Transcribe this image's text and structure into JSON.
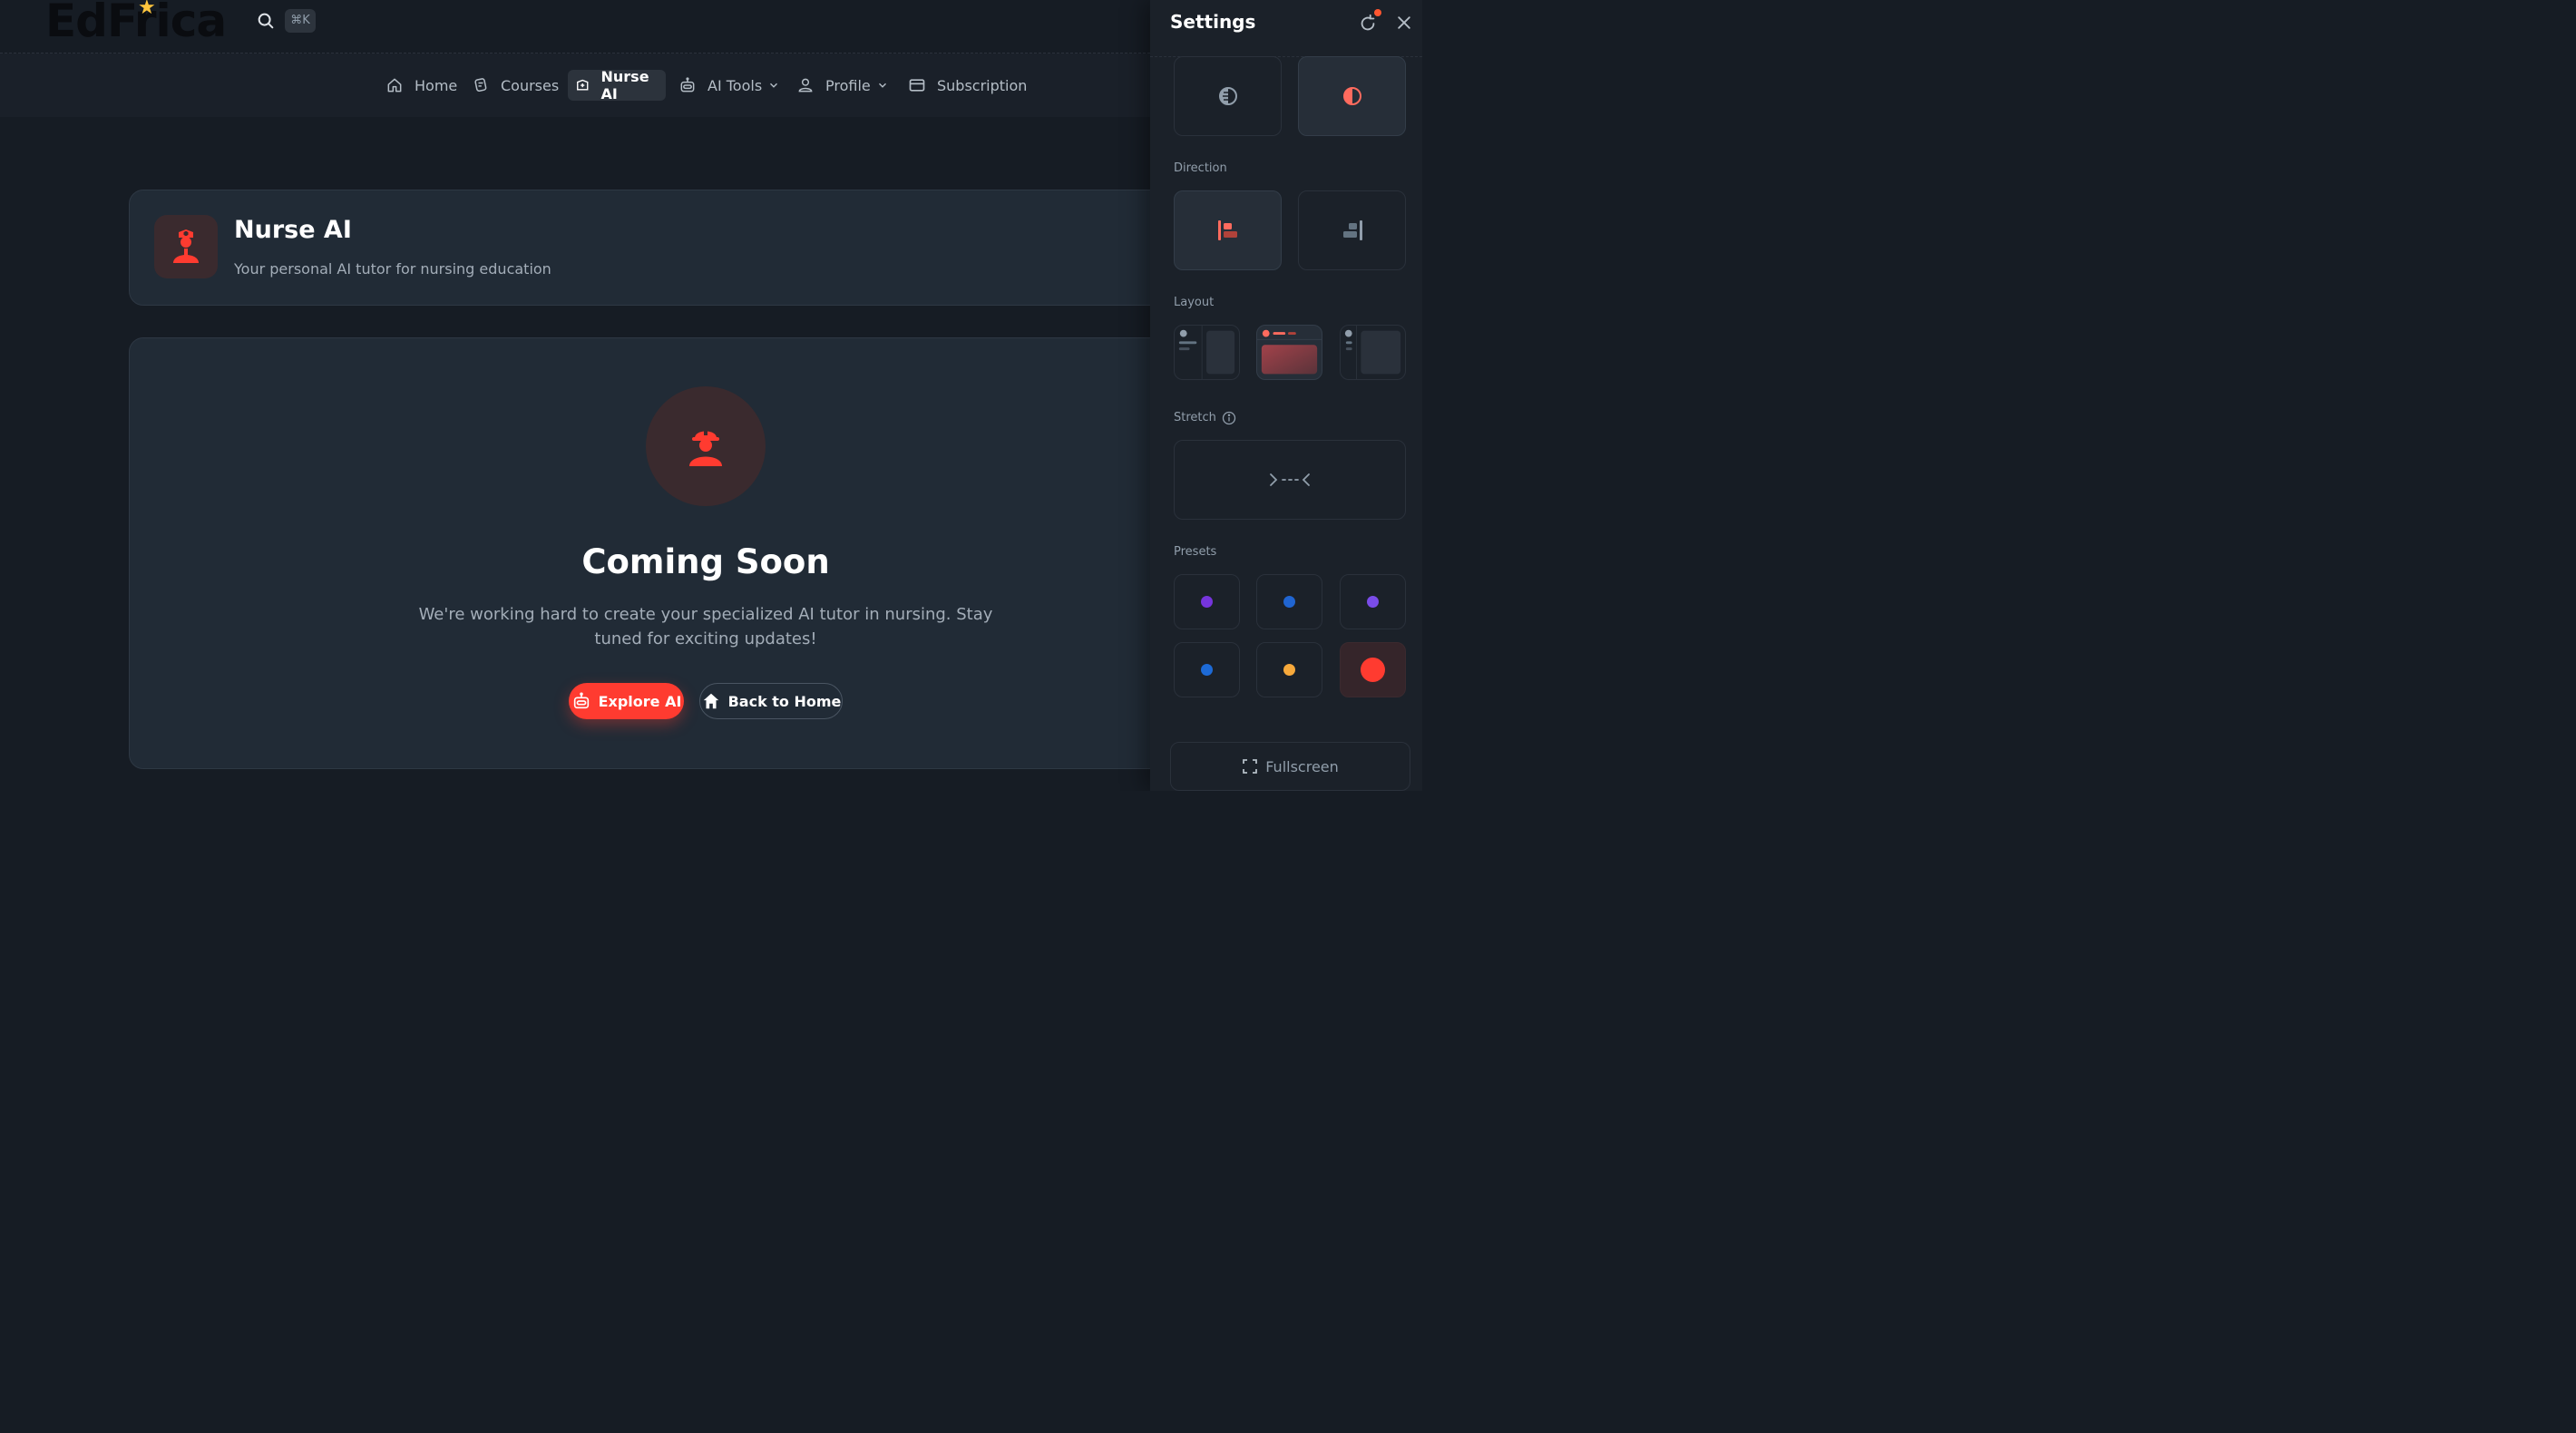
{
  "brand": {
    "logo_text": "EdFrica"
  },
  "search": {
    "shortcut": "⌘K"
  },
  "nav": {
    "items": [
      {
        "label": "Home",
        "icon": "home-icon"
      },
      {
        "label": "Courses",
        "icon": "courses-icon"
      },
      {
        "label": "Nurse AI",
        "icon": "nurse-icon",
        "active": true
      },
      {
        "label": "AI Tools",
        "icon": "robot-icon",
        "dropdown": true
      },
      {
        "label": "Profile",
        "icon": "user-icon",
        "dropdown": true
      },
      {
        "label": "Subscription",
        "icon": "card-icon"
      }
    ]
  },
  "page_header": {
    "title": "Nurse AI",
    "subtitle": "Your personal AI tutor for nursing education"
  },
  "coming_soon": {
    "title": "Coming Soon",
    "description": "We're working hard to create your specialized AI tutor in nursing. Stay tuned for exciting updates!",
    "explore_label": "Explore AI",
    "home_label": "Back to Home"
  },
  "settings": {
    "title": "Settings",
    "direction_label": "Direction",
    "layout_label": "Layout",
    "stretch_label": "Stretch",
    "presets_label": "Presets",
    "fullscreen_label": "Fullscreen",
    "presets": [
      "#7635dc",
      "#2065d1",
      "#7a4ce8",
      "#1d6ad6",
      "#f7a93b",
      "#ff3b30"
    ],
    "selected_preset": 5
  },
  "colors": {
    "accent": "#ff3b30",
    "background": "#161c24",
    "card": "#212b36"
  }
}
